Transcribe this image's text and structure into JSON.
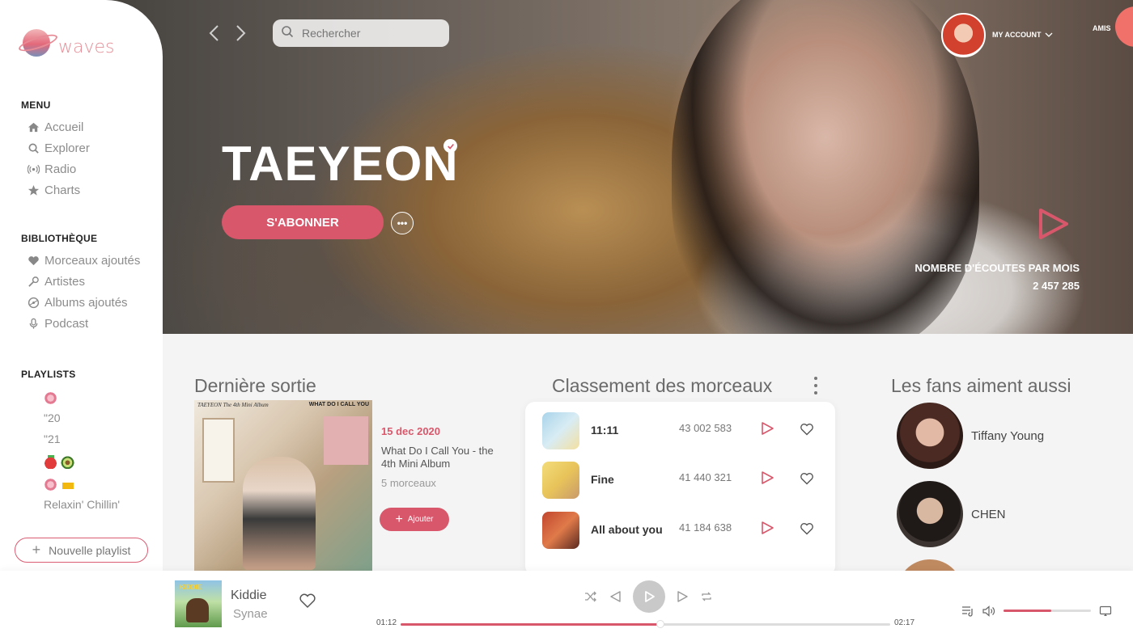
{
  "app": {
    "logo_text": "waves"
  },
  "colors": {
    "accent": "#d9576b",
    "sidebar_bg": "#ffffff",
    "page_bg": "#f4f4f4"
  },
  "sidebar": {
    "menu_title": "MENU",
    "menu": [
      {
        "label": "Accueil",
        "icon": "home-icon"
      },
      {
        "label": "Explorer",
        "icon": "search-icon"
      },
      {
        "label": "Radio",
        "icon": "radio-icon"
      },
      {
        "label": "Charts",
        "icon": "star-icon"
      }
    ],
    "library_title": "BIBLIOTHÈQUE",
    "library": [
      {
        "label": "Morceaux ajoutés",
        "icon": "heart-icon"
      },
      {
        "label": "Artistes",
        "icon": "microphone-icon"
      },
      {
        "label": "Albums ajoutés",
        "icon": "disc-icon"
      },
      {
        "label": "Podcast",
        "icon": "mic-icon"
      }
    ],
    "playlists_title": "PLAYLISTS",
    "playlists": [
      {
        "label": "",
        "emoji": [
          "flower-emoji"
        ]
      },
      {
        "label": "\"20"
      },
      {
        "label": "\"21"
      },
      {
        "label": "",
        "emoji": [
          "strawberry-emoji",
          "avocado-emoji"
        ]
      },
      {
        "label": "",
        "emoji": [
          "flower-emoji",
          "crown-emoji"
        ]
      },
      {
        "label": "Relaxin' Chillin'"
      }
    ],
    "new_playlist": "Nouvelle playlist"
  },
  "topbar": {
    "search_placeholder": "Rechercher",
    "account": "MY ACCOUNT",
    "friends": "AMIS"
  },
  "hero": {
    "artist": "TAEYEON",
    "subscribe": "S'ABONNER",
    "more": "•••",
    "listens_label": "NOMBRE D'ÉCOUTES PAR MOIS",
    "listens_value": "2 457 285"
  },
  "latest": {
    "heading": "Dernière sortie",
    "cover_top_left": "TAEYEON The 4th Mini Album",
    "cover_top_right": "WHAT DO I CALL YOU",
    "date": "15 dec 2020",
    "title": "What Do I Call You - the 4th Mini Album",
    "count": "5 morceaux",
    "add": "Ajouter"
  },
  "ranking": {
    "heading": "Classement des morceaux",
    "tracks": [
      {
        "name": "11:11",
        "plays": "43 002 583"
      },
      {
        "name": "Fine",
        "plays": "41 440 321"
      },
      {
        "name": "All about you",
        "plays": "41 184 638"
      }
    ]
  },
  "fans": {
    "heading": "Les fans aiment aussi",
    "artists": [
      {
        "name": "Tiffany Young"
      },
      {
        "name": "CHEN"
      }
    ]
  },
  "player": {
    "title": "Kiddie",
    "artist": "Synae",
    "cover_text": "KIDDIE",
    "current": "01:12",
    "total": "02:17",
    "progress": 0.53,
    "volume": 0.55
  }
}
